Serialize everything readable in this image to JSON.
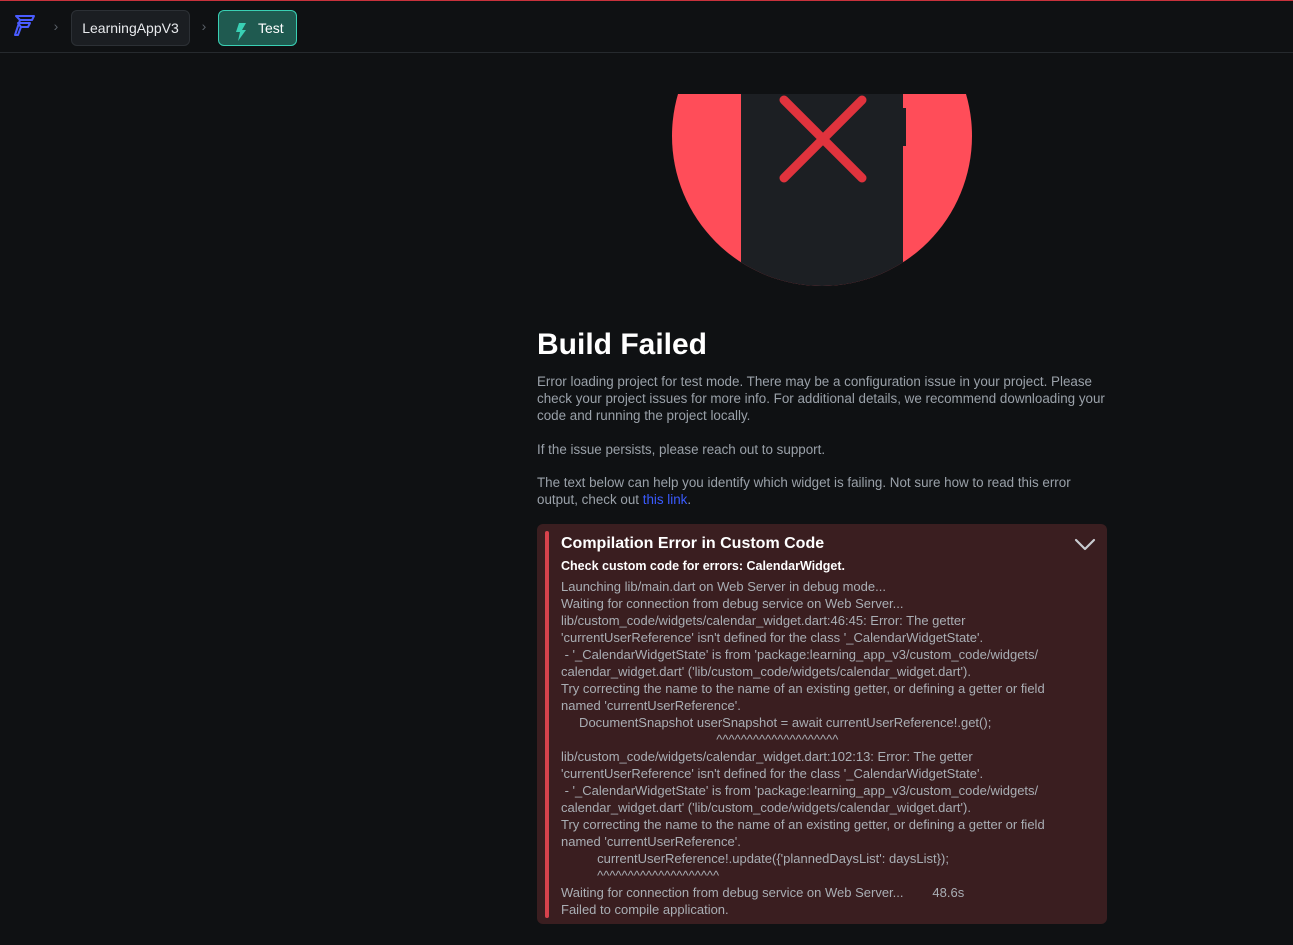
{
  "colors": {
    "accent": "#39d0b4",
    "error_red": "#ff4d59",
    "link": "#3a5bff",
    "panel_bg": "#3a1e20"
  },
  "topbar": {
    "logo_icon": "flutterflow-logo-icon",
    "project_label": "LearningAppV3",
    "test_label": "Test",
    "test_icon": "bolt-icon"
  },
  "main": {
    "hero_icon": "phone-error-icon",
    "title": "Build Failed",
    "paragraph1": "Error loading project for test mode. There may be a configuration issue in your project. Please check your project issues for more info. For additional details, we recommend downloading your code and running the project locally.",
    "paragraph2": "If the issue persists, please reach out to support.",
    "paragraph3_prefix": "The text below can help you identify which widget is failing. Not sure how to read this error output, check out ",
    "paragraph3_link": "this link",
    "paragraph3_suffix": "."
  },
  "error": {
    "title": "Compilation Error in Custom Code",
    "subtitle": "Check custom code for errors: CalendarWidget.",
    "log_lines": [
      "Launching lib/main.dart on Web Server in debug mode...",
      "Waiting for connection from debug service on Web Server...",
      "lib/custom_code/widgets/calendar_widget.dart:46:45: Error: The getter",
      "'currentUserReference' isn't defined for the class '_CalendarWidgetState'.",
      " - '_CalendarWidgetState' is from 'package:learning_app_v3/custom_code/widgets/",
      "calendar_widget.dart' ('lib/custom_code/widgets/calendar_widget.dart').",
      "Try correcting the name to the name of an existing getter, or defining a getter or field",
      "named 'currentUserReference'.",
      "     DocumentSnapshot userSnapshot = await currentUserReference!.get();",
      "                                           ^^^^^^^^^^^^^^^^^^^^",
      "lib/custom_code/widgets/calendar_widget.dart:102:13: Error: The getter",
      "'currentUserReference' isn't defined for the class '_CalendarWidgetState'.",
      " - '_CalendarWidgetState' is from 'package:learning_app_v3/custom_code/widgets/",
      "calendar_widget.dart' ('lib/custom_code/widgets/calendar_widget.dart').",
      "Try correcting the name to the name of an existing getter, or defining a getter or field",
      "named 'currentUserReference'.",
      "          currentUserReference!.update({'plannedDaysList': daysList});",
      "          ^^^^^^^^^^^^^^^^^^^^",
      "Waiting for connection from debug service on Web Server...        48.6s",
      "Failed to compile application."
    ]
  }
}
